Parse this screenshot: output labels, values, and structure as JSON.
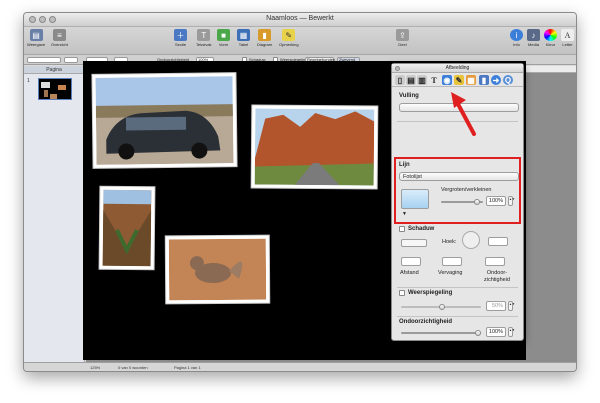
{
  "window": {
    "title": "Naamloos — Bewerkt"
  },
  "toolbar": {
    "left": [
      {
        "label": "Weergave",
        "icon": "view-icon"
      },
      {
        "label": "Overzicht",
        "icon": "outline-icon"
      }
    ],
    "center": [
      {
        "label": "Sectie",
        "icon": "section-icon"
      },
      {
        "label": "Tekstvak",
        "icon": "textbox-icon"
      },
      {
        "label": "Vorm",
        "icon": "shape-icon"
      },
      {
        "label": "Tabel",
        "icon": "table-icon"
      },
      {
        "label": "Diagram",
        "icon": "chart-icon"
      },
      {
        "label": "Opmerking",
        "icon": "comment-icon"
      }
    ],
    "share": {
      "label": "Deel",
      "icon": "share-icon"
    },
    "right": [
      {
        "label": "Info",
        "icon": "info-icon"
      },
      {
        "label": "Media",
        "icon": "media-icon"
      },
      {
        "label": "Kleur",
        "icon": "color-icon"
      },
      {
        "label": "Letter",
        "icon": "font-icon"
      }
    ]
  },
  "formatbar": {
    "opacity_label": "Ondoorzichtigheid",
    "opacity_value": "100%",
    "shadow_label": "Schaduw",
    "reflection_label": "Weerspiegeling",
    "regular_btn": "Regelgebonden",
    "floating_btn": "Zwevend"
  },
  "sidebar": {
    "header": "Pagina",
    "page_num": "1"
  },
  "status": {
    "zoom": "125%",
    "words": "0 van 0 woorden",
    "page": "Pagina 1 van 1"
  },
  "inspector": {
    "title": "Afbeelding",
    "fill_label": "Vulling",
    "stroke_label": "Lijn",
    "stroke_style": "Fotolijst",
    "scale_label": "Vergroten/verkleinen",
    "scale_value": "100%",
    "shadow_label": "Schaduw",
    "angle_label": "Hoek:",
    "distance_label": "Afstand",
    "blur_label": "Vervaging",
    "opacity_small_label": "Ondoor-zichtigheid",
    "reflection_label": "Weerspiegeling",
    "reflection_value": "50%",
    "opacity_label": "Ondoorzichtigheid",
    "opacity_value": "100%"
  },
  "colors": {
    "highlight": "#e02020",
    "page": "#000000",
    "accent": "#3d7fd9"
  }
}
